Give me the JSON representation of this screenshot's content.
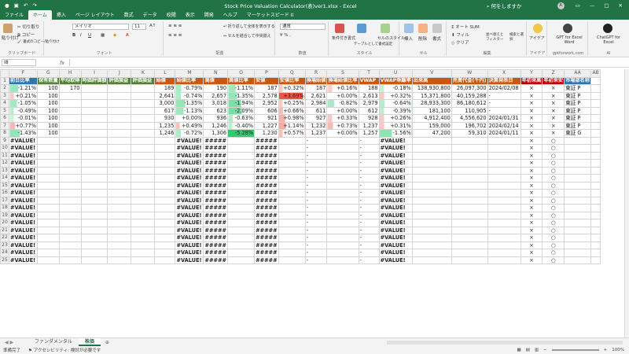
{
  "title": "Stock Price Valuation Calculator(表)ver1.xlsx  -  Excel",
  "search_label": "何をしますか",
  "avatar_letter": "A",
  "menu": [
    "ファイル",
    "ホーム",
    "挿入",
    "ページ レイアウト",
    "数式",
    "データ",
    "校閲",
    "表示",
    "開発",
    "ヘルプ",
    "マーケットスピード II"
  ],
  "ribbon": {
    "clipboard": {
      "paste": "貼り付け",
      "cut": "切り取り",
      "copy": "コピー",
      "format_painter": "書式のコピー/貼り付け",
      "label": "クリップボード"
    },
    "font": {
      "name": "メイリオ",
      "size": "11",
      "label": "フォント"
    },
    "align": {
      "wrap": "折り返して全体を表示する",
      "merge": "セルを結合して中央揃え",
      "label": "配置"
    },
    "number": {
      "format": "通貨",
      "label": "数値"
    },
    "styles": {
      "cond": "条件付き書式",
      "table": "テーブルとして書式設定",
      "cell": "セルのスタイル",
      "label": "スタイル"
    },
    "cells": {
      "insert": "挿入",
      "delete": "削除",
      "format": "書式",
      "label": "セル"
    },
    "edit": {
      "autosum": "オート SUM",
      "fill": "フィル",
      "clear": "クリア",
      "sort": "並べ替えとフィルター",
      "find": "検索と選択",
      "label": "編集"
    },
    "ideas": {
      "btn": "アイデア",
      "label": "アイデア"
    },
    "gpt_word": {
      "btn": "GPT for Excel Word",
      "sub": "gptforwork.com"
    },
    "chatgpt": {
      "btn": "ChatGPT for Excel",
      "label": "AI"
    }
  },
  "namebox": "I8",
  "fx": "fx",
  "columns": [
    "F",
    "G",
    "H",
    "I",
    "J",
    "K",
    "L",
    "M",
    "N",
    "O",
    "P",
    "Q",
    "R",
    "S",
    "T",
    "U",
    "V",
    "W",
    "X",
    "Y",
    "Z",
    "AA",
    "AB"
  ],
  "headers": [
    "前日比率",
    "保有数量",
    "平均取得",
    "時価評価額",
    "評価損益",
    "評価損益",
    "始値",
    "始値比率",
    "高値",
    "高値比率",
    "安値",
    "安値比率",
    "換場始値",
    "換場始値比率",
    "VWAP",
    "VWAP乖離率",
    "出来高",
    "売買代金(千円)",
    "決算発表日",
    "年初来高",
    "年初来安",
    "市場部名称",
    ""
  ],
  "header_colors": [
    "#2e75b6",
    "#548235",
    "#548235",
    "#548235",
    "#548235",
    "#548235",
    "#c65911",
    "#c65911",
    "#c65911",
    "#c65911",
    "#c65911",
    "#c65911",
    "#c65911",
    "#c65911",
    "#c65911",
    "#c65911",
    "#c65911",
    "#c65911",
    "#c65911",
    "#c00000",
    "#c00000",
    "#2e75b6",
    "#ffffff"
  ],
  "rows": [
    [
      "-1.21%",
      "100",
      "170",
      "",
      "",
      "",
      "189",
      "-0.79%",
      "190",
      "-1.11%",
      "187",
      "+0.32%",
      "187",
      "+0.16%",
      "188",
      "-0.18%",
      "138,930,800",
      "26,097,300",
      "2024/02/08",
      "×",
      "×",
      "東証 P",
      ""
    ],
    [
      "+0.21%",
      "100",
      "",
      "",
      "",
      "",
      "2,641",
      "-0.74%",
      "2,657",
      "-1.35%",
      "2,578",
      "+3.69%",
      "2,621",
      "+0.00%",
      "2,613",
      "+0.32%",
      "15,371,800",
      "40,159,288",
      "-",
      "×",
      "×",
      "東証 P",
      ""
    ],
    [
      "-1.05%",
      "100",
      "",
      "",
      "",
      "",
      "3,000",
      "-1.35%",
      "3,018",
      "-1.94%",
      "2,952",
      "+0.25%",
      "2,984",
      "-0.82%",
      "2,979",
      "-0.64%",
      "28,933,300",
      "86,180,612",
      "-",
      "×",
      "×",
      "東証 P",
      ""
    ],
    [
      "-0.49%",
      "100",
      "",
      "",
      "",
      "",
      "617",
      "-1.13%",
      "623",
      "-2.09%",
      "606",
      "+0.66%",
      "611",
      "+0.00%",
      "612",
      "-0.39%",
      "181,100",
      "110,905",
      "-",
      "×",
      "×",
      "東証 P",
      ""
    ],
    [
      "-0.01%",
      "100",
      "",
      "",
      "",
      "",
      "930",
      "+0.00%",
      "936",
      "-0.63%",
      "921",
      "+0.98%",
      "927",
      "+0.33%",
      "928",
      "+0.26%",
      "4,912,400",
      "4,556,620",
      "2024/01/31",
      "×",
      "×",
      "東証 P",
      ""
    ],
    [
      "+0.77%",
      "100",
      "",
      "",
      "",
      "",
      "1,235",
      "+0.49%",
      "1,246",
      "-0.40%",
      "1,227",
      "+1.14%",
      "1,232",
      "+0.73%",
      "1,237",
      "+0.31%",
      "159,000",
      "196,702",
      "2024/02/14",
      "×",
      "×",
      "東証 P",
      ""
    ],
    [
      "-1.43%",
      "100",
      "",
      "",
      "",
      "",
      "1,246",
      "-0.72%",
      "1,306",
      "-5.28%",
      "1,230",
      "+0.57%",
      "1,237",
      "+0.00%",
      "1,257",
      "-1.56%",
      "47,200",
      "59,310",
      "2024/01/11",
      "×",
      "×",
      "東証 G",
      ""
    ]
  ],
  "err_row": {
    "F": "#VALUE!",
    "M": "#VALUE!",
    "N": "#####",
    "P": "#####",
    "R": "-",
    "T": "-",
    "U": "#VALUE!",
    "Y": "×",
    "Z": "○"
  },
  "sheet_tabs": [
    "ファンダメンタル",
    "株価"
  ],
  "status_ready": "準備完了",
  "status_access": "アクセシビリティ: 検討が必要です",
  "zoom": "100%"
}
